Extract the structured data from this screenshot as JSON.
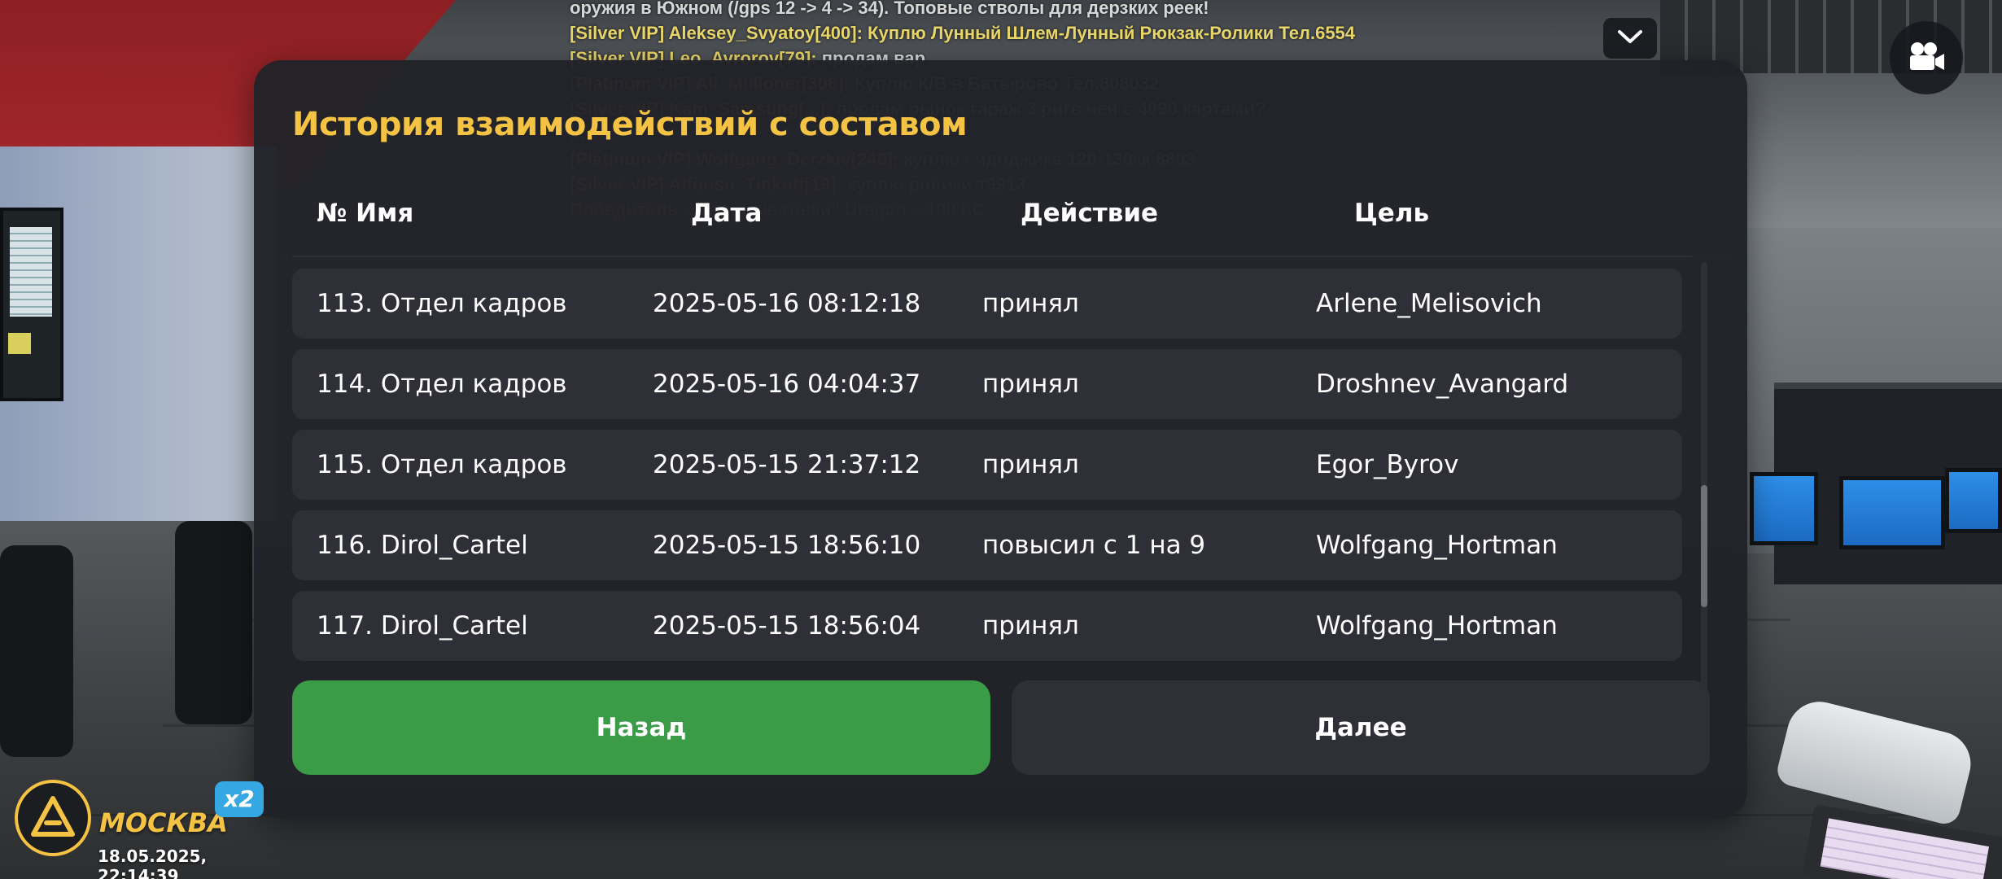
{
  "chat": {
    "lines": [
      {
        "prefix": "",
        "text": "оружия в Южном (/gps 12 -> 4 -> 34). Топовые стволы для дерзких реек!"
      },
      {
        "prefix": "[Silver VIP] Aleksey_Svyatoy[400]:",
        "text": " Куплю Лунный Шлем-Лунный Рюкзак-Ролики Тел.6554"
      },
      {
        "prefix": "[Silver VIP] Leo_Avrorov[79]:",
        "text": " продам вар"
      },
      {
        "prefix": "[Platinum VIP] Ali_Millioner[306]:",
        "text": " Куплю К/В в Батырово Тел.808032"
      },
      {
        "prefix": "[Silver VIP] Kam_Samsung[...]:",
        "text": " продам рынок гараж 3 ригв чен с 4090 картами?"
      },
      {
        "prefix": "",
        "text": "..."
      },
      {
        "prefix": "[Platinum VIP] Wolfgang_Derzkiv[248]:",
        "text": " куплю сидоджика 120-130кк 8803"
      },
      {
        "prefix": "[Silver VIP] Alfonso_Tinkoff[19]:",
        "text": " куплю ролики т9913"
      },
      {
        "prefix": "Победитель",
        "text": " ...ральные гонки\" Uragan... 100 LC"
      }
    ]
  },
  "topbar": {
    "collapse_icon": "chevron-down-icon",
    "camera_icon": "video-camera-icon"
  },
  "dialog": {
    "title": "История взаимодействий с составом",
    "columns": {
      "name": "№ Имя",
      "date": "Дата",
      "action": "Действие",
      "target": "Цель"
    },
    "rows": [
      {
        "name": "113. Отдел кадров",
        "date": "2025-05-16 08:12:18",
        "action": "принял",
        "target": "Arlene_Melisovich"
      },
      {
        "name": "114. Отдел кадров",
        "date": "2025-05-16 04:04:37",
        "action": "принял",
        "target": "Droshnev_Avangard"
      },
      {
        "name": "115. Отдел кадров",
        "date": "2025-05-15 21:37:12",
        "action": "принял",
        "target": "Egor_Byrov"
      },
      {
        "name": "116. Dirol_Cartel",
        "date": "2025-05-15 18:56:10",
        "action": "повысил с 1 на 9",
        "target": "Wolfgang_Hortman"
      },
      {
        "name": "117. Dirol_Cartel",
        "date": "2025-05-15 18:56:04",
        "action": "принял",
        "target": "Wolfgang_Hortman"
      }
    ],
    "scroll_position": 0.72,
    "buttons": {
      "back": "Назад",
      "next": "Далее"
    },
    "colors": {
      "title": "#f5c344",
      "back_button": "#3a9c47",
      "next_button": "#2e2f37",
      "panel": "#212228"
    }
  },
  "server": {
    "city": "МОСКВА",
    "multiplier": "x2",
    "datetime": "18.05.2025, 22:14:39"
  }
}
